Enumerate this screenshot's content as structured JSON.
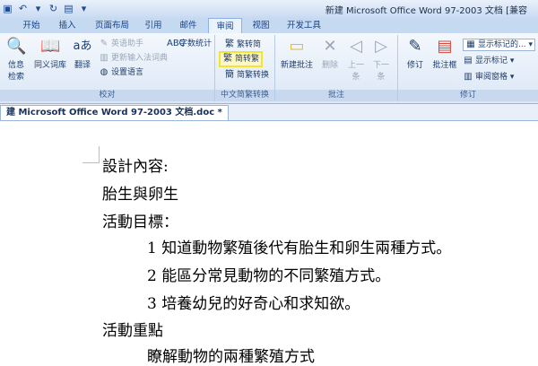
{
  "window": {
    "title": "新建 Microsoft Office Word 97-2003 文档 [兼容"
  },
  "tabs": [
    "开始",
    "插入",
    "页面布局",
    "引用",
    "邮件",
    "审阅",
    "视图",
    "开发工具"
  ],
  "active_tab": "审阅",
  "ribbon": {
    "proofing": {
      "label": "校对",
      "info_search": "信息\n检索",
      "thesaurus": "同义词库",
      "translate": "翻译",
      "english_assistant": "英语助手",
      "update_ime_dictionary": "更新输入法词典",
      "set_language": "设置语言",
      "word_count": "字数统计"
    },
    "chinese_conversion": {
      "label": "中文简繁转换",
      "to_simplified": "繁转简",
      "to_traditional": "简转繁",
      "conversion": "简繁转换"
    },
    "comments": {
      "label": "批注",
      "new_comment": "新建批注",
      "delete": "删除",
      "previous": "上一\n条",
      "next": "下一\n条"
    },
    "tracking": {
      "label": "修订",
      "track_changes": "修订",
      "balloons": "批注框",
      "display_for_review": "显示标记的...",
      "show_markup": "显示标记",
      "reviewing_pane": "审阅窗格"
    }
  },
  "document_tab": "建 Microsoft Office Word 97-2003 文档.doc *",
  "document": {
    "lines": [
      "設計內容:",
      "胎生與卵生",
      "活動目標：",
      "1  知道動物繁殖後代有胎生和卵生兩種方式。",
      "2  能區分常見動物的不同繁殖方式。",
      "3  培養幼兒的好奇心和求知欲。",
      "活動重點",
      "瞭解動物的兩種繁殖方式"
    ]
  },
  "colors": {
    "ribbon_bg": "#dbe7f6",
    "tab_text": "#15428b",
    "highlight": "#f0e43a"
  }
}
